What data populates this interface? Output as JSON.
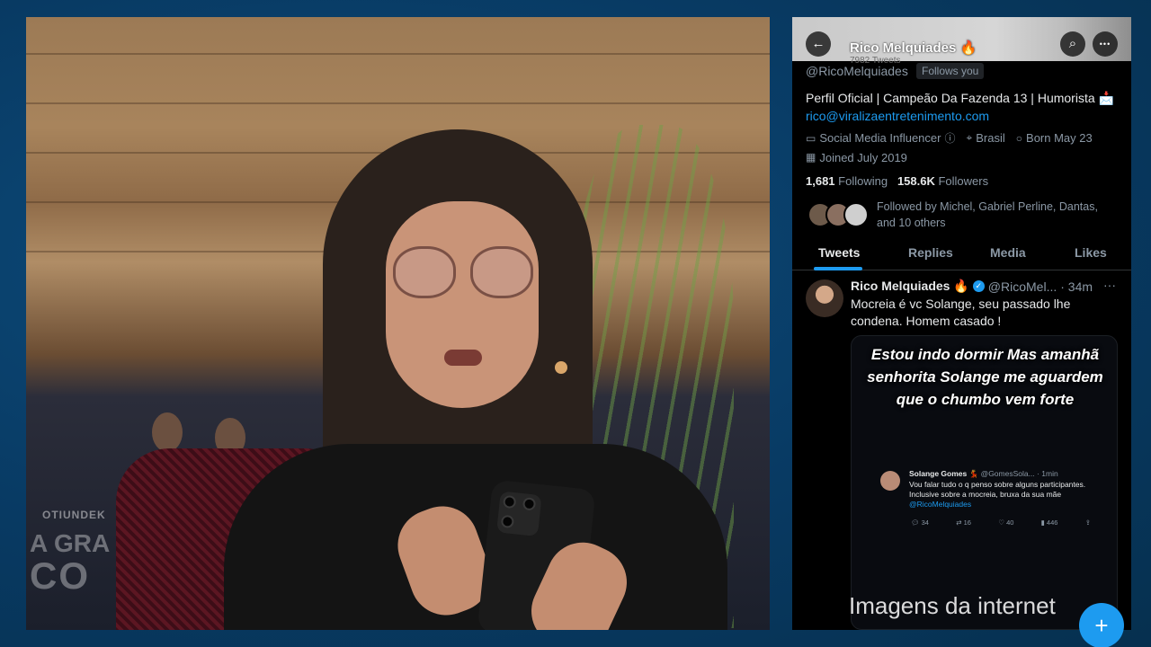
{
  "profile": {
    "name": "Rico Melquiades 🔥",
    "tweet_count": "7982 Tweets",
    "handle": "@RicoMelquiades",
    "follows_you": "Follows you",
    "bio": "Perfil Oficial | Campeão Da Fazenda 13 | Humorista 📩",
    "email": "rico@viralizaentretenimento.com",
    "category": "Social Media Influencer",
    "location": "Brasil",
    "birthday": "Born May 23",
    "joined": "Joined July 2019",
    "following_count": "1,681",
    "following_label": "Following",
    "followers_count": "158.6K",
    "followers_label": "Followers",
    "followed_by": "Followed by Michel, Gabriel Perline, Dantas, and 10 others"
  },
  "header_buttons": {
    "back": "←",
    "search": "⌕",
    "more": "•••"
  },
  "tabs": [
    {
      "label": "Tweets",
      "active": true
    },
    {
      "label": "Replies",
      "active": false
    },
    {
      "label": "Media",
      "active": false
    },
    {
      "label": "Likes",
      "active": false
    }
  ],
  "tweet": {
    "name": "Rico Melquiades 🔥",
    "handle": "@RicoMel...",
    "time": "· 34m",
    "more": "···",
    "text": "Mocreia é vc Solange, seu passado lhe condena.  Homem casado !",
    "media_caption": "Estou indo dormir Mas amanhã senhorita Solange me aguardem que o chumbo vem forte",
    "embedded": {
      "name": "Solange Gomes 💃",
      "handle": "@GomesSola...",
      "time": "· 1min",
      "text": "Vou falar tudo o q penso sobre alguns participantes. Inclusive sobre a mocreia, bruxa da sua mãe",
      "mention": "@RicoMelquiades",
      "replies": "34",
      "retweets": "16",
      "likes": "40",
      "views": "446"
    }
  },
  "overlay": {
    "watermark": "Imagens da internet",
    "fab": "+"
  },
  "colors": {
    "accent": "#1d9bf0",
    "background": "#083a63",
    "text_secondary": "#8b98a5"
  }
}
